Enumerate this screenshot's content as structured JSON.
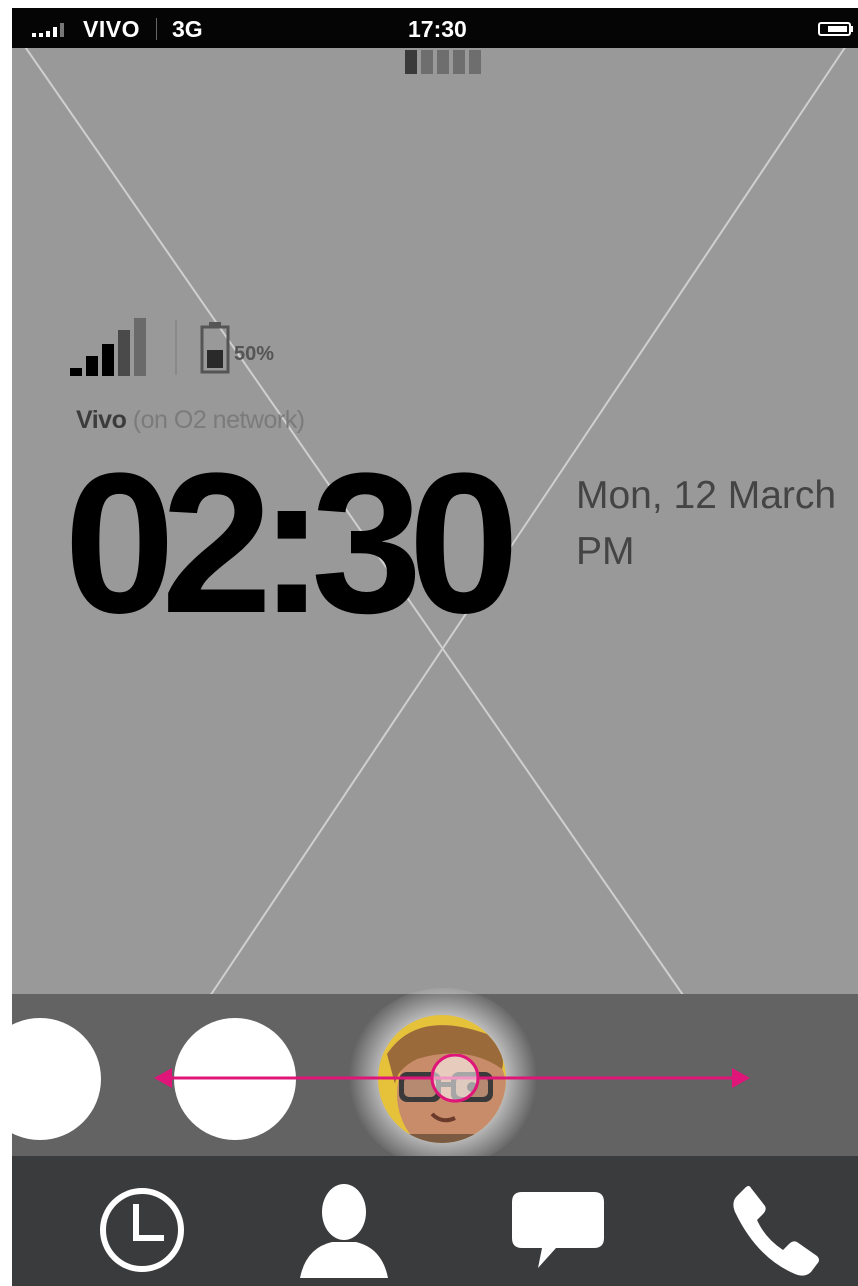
{
  "status_bar": {
    "carrier": "VIVO",
    "network": "3G",
    "time": "17:30"
  },
  "lockscreen": {
    "battery_percent": "50%",
    "carrier_name": "Vivo",
    "network_note": "(on O2 network)",
    "clock": "02:30",
    "date": "Mon, 12 March",
    "ampm": "PM"
  },
  "icons": {
    "signal": "signal-strength-icon",
    "battery": "battery-icon",
    "recent": "clock-icon",
    "contacts": "person-icon",
    "messages": "speech-bubble-icon",
    "phone": "phone-icon"
  },
  "colors": {
    "background": "#999999",
    "status_bar": "#050505",
    "carousel": "#636363",
    "tab_bar": "#3a3b3d",
    "swipe_arrow": "#e0157a"
  }
}
